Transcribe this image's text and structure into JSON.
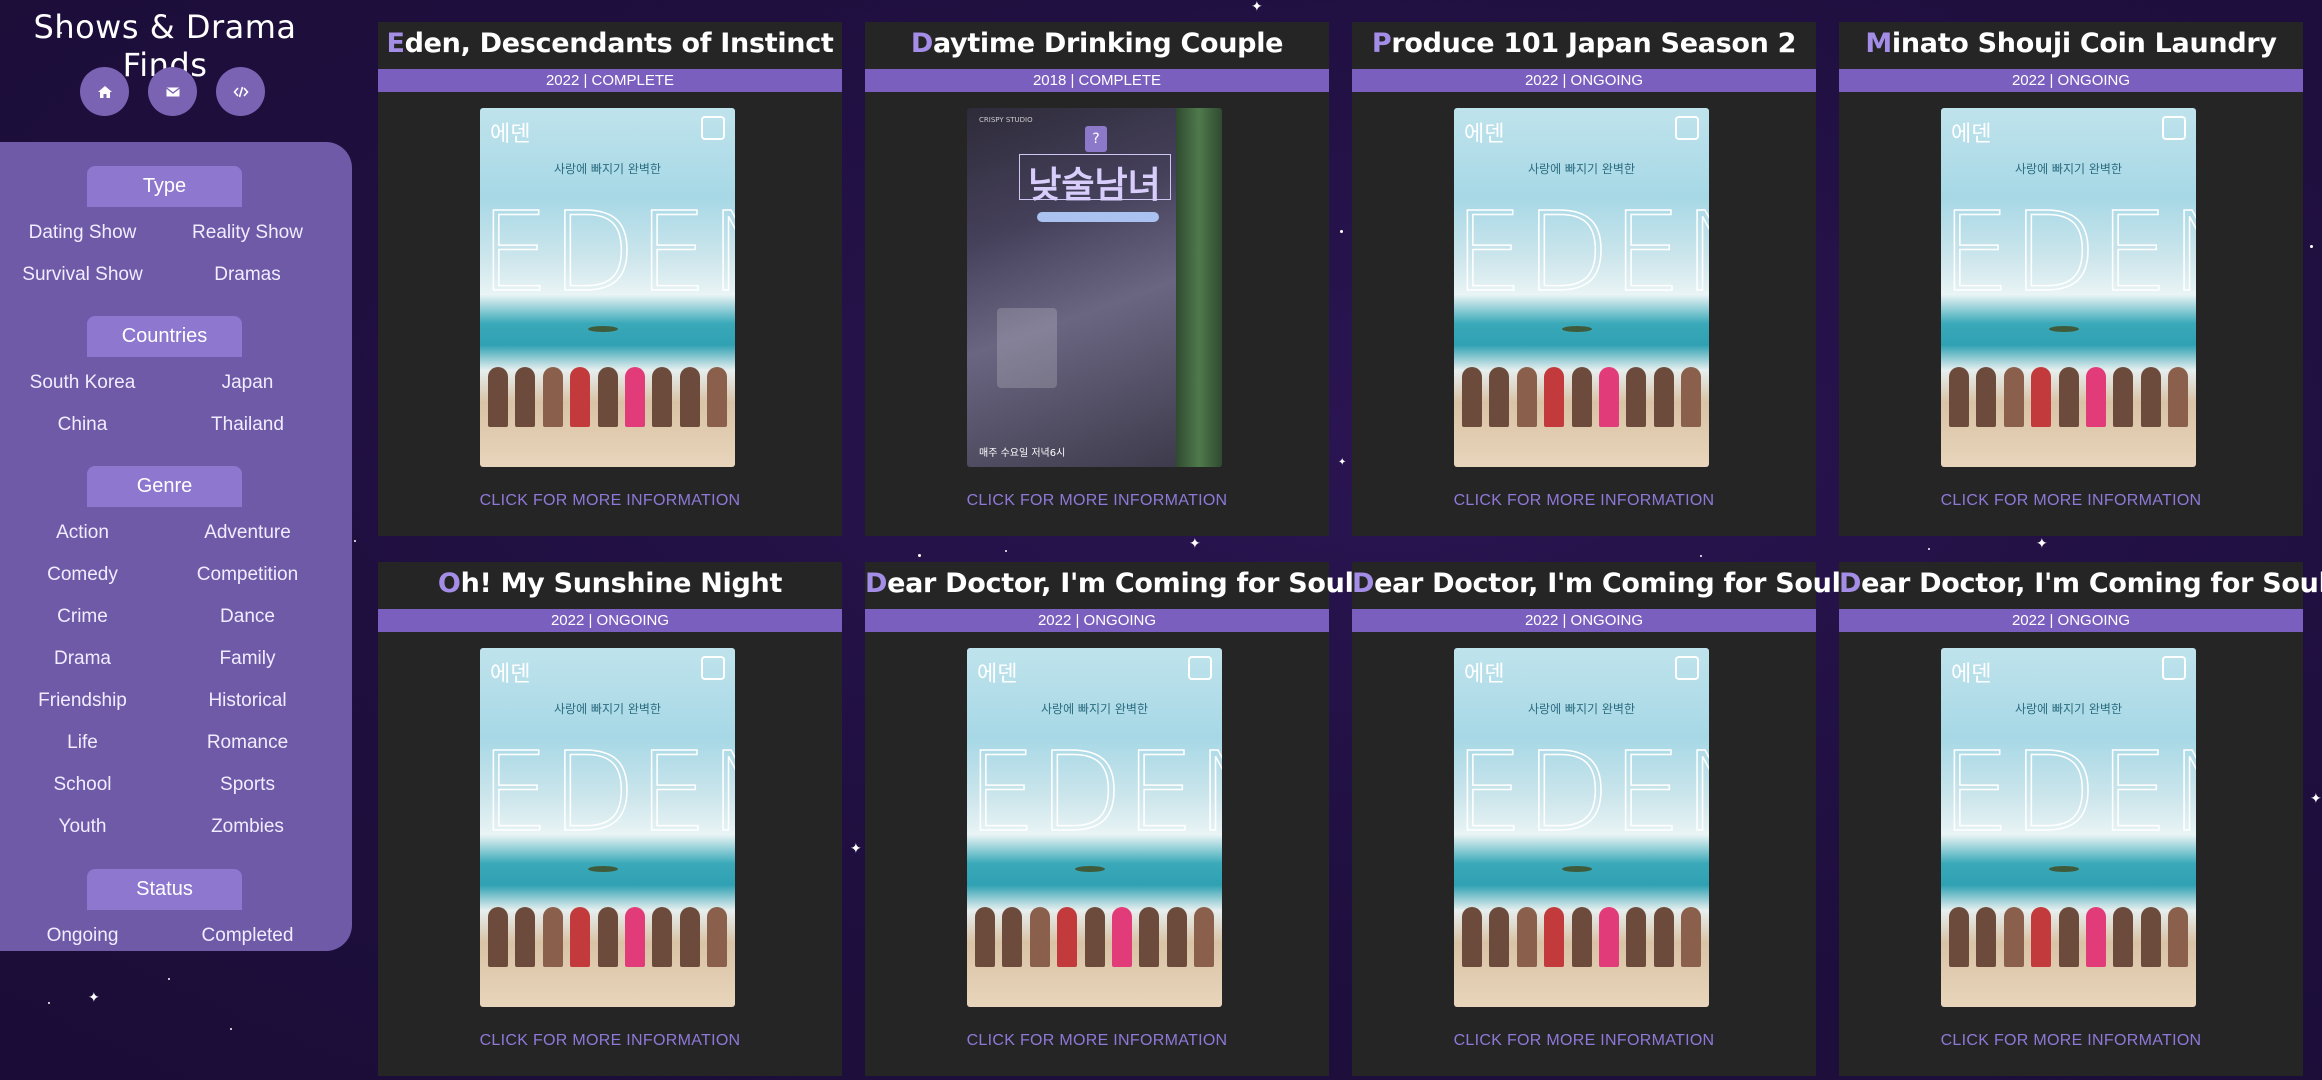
{
  "site": {
    "title": "Shows & Drama Finds"
  },
  "nav": [
    {
      "icon": "home-icon"
    },
    {
      "icon": "mail-icon"
    },
    {
      "icon": "code-icon"
    }
  ],
  "filters": {
    "type": {
      "header": "Type",
      "options": [
        "Dating Show",
        "Reality Show",
        "Survival Show",
        "Dramas"
      ]
    },
    "countries": {
      "header": "Countries",
      "options": [
        "South Korea",
        "Japan",
        "China",
        "Thailand"
      ]
    },
    "genre": {
      "header": "Genre",
      "options": [
        "Action",
        "Adventure",
        "Comedy",
        "Competition",
        "Crime",
        "Dance",
        "Drama",
        "Family",
        "Friendship",
        "Historical",
        "Life",
        "Romance",
        "School",
        "Sports",
        "Youth",
        "Zombies"
      ]
    },
    "status": {
      "header": "Status",
      "options": [
        "Ongoing",
        "Completed"
      ]
    }
  },
  "cards": [
    {
      "initial": "E",
      "rest": "den, Descendants of Instinct",
      "meta": "2022 | COMPLETE",
      "poster": "eden",
      "link": "CLICK FOR MORE INFORMATION"
    },
    {
      "initial": "D",
      "rest": "aytime Drinking Couple",
      "meta": "2018 | COMPLETE",
      "poster": "daytime",
      "link": "CLICK FOR MORE INFORMATION"
    },
    {
      "initial": "P",
      "rest": "roduce 101 Japan Season 2",
      "meta": "2022 | ONGOING",
      "poster": "eden",
      "link": "CLICK FOR MORE INFORMATION"
    },
    {
      "initial": "M",
      "rest": "inato Shouji Coin Laundry",
      "meta": "2022 | ONGOING",
      "poster": "eden",
      "link": "CLICK FOR MORE INFORMATION"
    },
    {
      "initial": "O",
      "rest": "h! My Sunshine Night",
      "meta": "2022 | ONGOING",
      "poster": "eden",
      "link": "CLICK FOR MORE INFORMATION"
    },
    {
      "initial": "D",
      "rest": "ear Doctor, I'm Coming for Soul",
      "meta": "2022 | ONGOING",
      "poster": "eden",
      "link": "CLICK FOR MORE INFORMATION"
    },
    {
      "initial": "D",
      "rest": "ear Doctor, I'm Coming for Soul",
      "meta": "2022 | ONGOING",
      "poster": "eden",
      "link": "CLICK FOR MORE INFORMATION"
    },
    {
      "initial": "D",
      "rest": "ear Doctor, I'm Coming for Soul",
      "meta": "2022 | ONGOING",
      "poster": "eden",
      "link": "CLICK FOR MORE INFORMATION"
    }
  ],
  "posters": {
    "eden": {
      "logo_text": "에덴",
      "tagline": "사랑에 빠지기 완벽한",
      "big_text": "EDEN"
    },
    "daytime": {
      "studio_text": "CRISPY STUDIO",
      "title_text": "낮술남녀",
      "footer_text": "매주 수요일 저녁6시"
    }
  }
}
